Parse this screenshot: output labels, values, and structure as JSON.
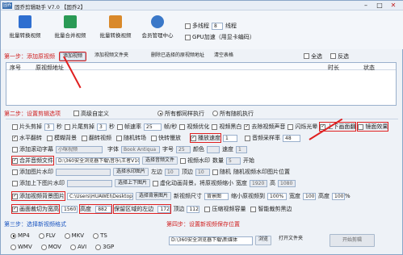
{
  "window": {
    "title": "固乔剪辑助手 V7.0 【固乔2】",
    "logo": "固乔",
    "min": "–",
    "max": "□",
    "close": "✕"
  },
  "toolbar": {
    "items": [
      {
        "label": "批量转换视频",
        "color": "#2f6fd0"
      },
      {
        "label": "批量合并视频",
        "color": "#2a9a55"
      },
      {
        "label": "批量转换视频",
        "color": "#d9892a"
      },
      {
        "label": "会员管理中心",
        "color": "#3a78c8"
      }
    ],
    "multithread": "多线程",
    "threads": "8",
    "thread_unit": "线程",
    "gpu": "GPU加速（用显卡编码）"
  },
  "step1": {
    "label": "第一步：添加原视频",
    "add_video": "添加视频",
    "add_folder": "添加视频文件夹",
    "delete": "删除已选择的原视频地址",
    "clear": "清空表格",
    "select_all": "全选",
    "invert": "反选",
    "col_no": "序号",
    "col_path": "原视频地址",
    "col_duration": "时长",
    "col_status": "状态"
  },
  "step2": {
    "label": "第二步：设置剪辑选项",
    "custom": "高级自定义",
    "exec_same": "所有都同样执行",
    "exec_random": "所有随机执行"
  },
  "r1": {
    "cut_head": "片头剪掉",
    "cut_head_v": "3",
    "sec": "秒",
    "cut_tail": "片尾剪掉",
    "cut_tail_v": "3",
    "fps": "帧速率",
    "fps_v": "25",
    "fps_unit": "帧/秒",
    "optimize": "视频优化",
    "black": "视频黑白",
    "mute": "去除视频声音",
    "flash": "闪烁光晕",
    "up_down": "上下画面翻",
    "mirror": "镜面效果"
  },
  "r2": {
    "h_flip": "水平翻转",
    "blur": "模糊背景",
    "rotate": "翻转视频",
    "prefix": "随机转场",
    "slow": "快转慢放",
    "speed": "播放速度",
    "speed_v": "1",
    "rate": "音频采样率",
    "rate_v": "48"
  },
  "r3": {
    "add_text": "添加滚动字幕",
    "text_v": "小咪视频",
    "font": "字体",
    "font_v": "Book Antiqua",
    "size": "字号",
    "size_v": "25",
    "color": "颜色",
    "speed": "速度",
    "speed_v": "1"
  },
  "r4": {
    "merge_audio": "合并音频文件",
    "audio_v": "D:\\360安全浏览器下载\\音乐\\王者V10",
    "choose": "选择音频文件",
    "loop": "视频水印",
    "count": "数量",
    "count_v": "5",
    "start": "开始"
  },
  "r5": {
    "add_watermark": "添加图片水印",
    "wm_v": "",
    "choose": "选择水印图片",
    "left": "左边",
    "left_v": "10",
    "top": "顶边",
    "top_v": "10",
    "pos": "随机",
    "pos_note": "随机视频水印图片位置"
  },
  "r6": {
    "add_bg": "添加上下图片水印",
    "bg_v": "",
    "choose": "选择上下图片",
    "note": "虚化动画背景，将原视频缩小",
    "width": "宽度",
    "width_v": "1920",
    "height": "高",
    "height_v": "1080"
  },
  "r7": {
    "add_pic": "添加视频背景图片",
    "pic_v": "C:\\Users\\HUAWEI\\Desktop\\背景图",
    "choose": "选择背景图片",
    "resize": "新视频尺寸",
    "resize_v": "背景图",
    "scale": "缩小原视频到",
    "scale_v": "100%",
    "w": "宽度",
    "w_v": "100",
    "h": "高度",
    "h_v": "100",
    "pct": "%",
    "auto": "智能视频尺寸"
  },
  "r8": {
    "frame": "画面裁切为宽高",
    "w_v": "1560",
    "h": "高度",
    "h_v": "882",
    "keep": "保留区域的左边",
    "left_v": "172",
    "top": "顶边",
    "top_v": "112",
    "crop": "压缩视频容量",
    "rot": "智能裁剪黑边"
  },
  "step3": {
    "label": "第三步：选择新视频格式",
    "formats": [
      "MP4",
      "FLV",
      "MKV",
      "TS",
      "WMV",
      "MOV",
      "AVI",
      "3GP"
    ]
  },
  "step4": {
    "label": "第四步：设置新视频保存位置",
    "path": "D:\\360安全浏览器下载\\新媒体",
    "browse": "浏览",
    "open": "打开文件夹",
    "start": "开始剪辑"
  }
}
